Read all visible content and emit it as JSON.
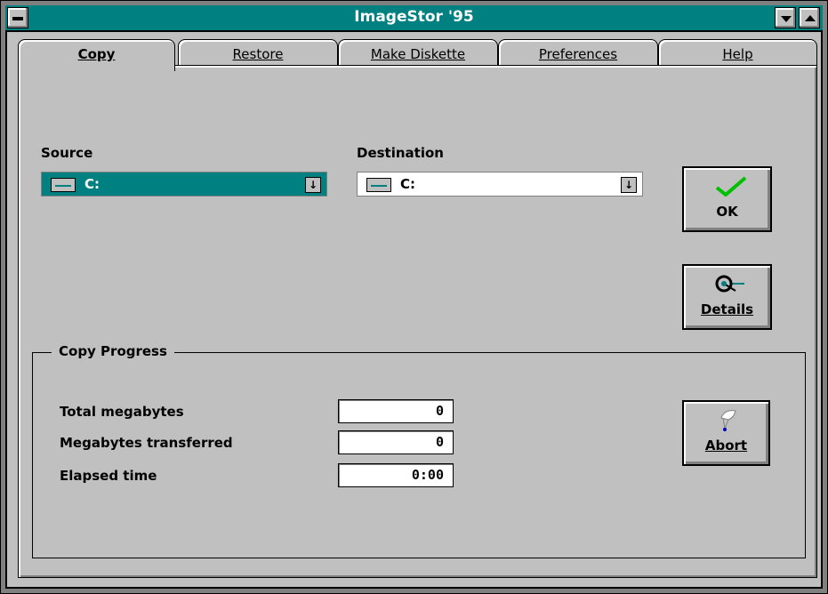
{
  "window": {
    "title": "ImageStor '95"
  },
  "tabs": [
    {
      "label": "Copy"
    },
    {
      "label": "Restore"
    },
    {
      "label": "Make Diskette"
    },
    {
      "label": "Preferences"
    },
    {
      "label": "Help"
    }
  ],
  "source": {
    "label": "Source",
    "value": "C:"
  },
  "destination": {
    "label": "Destination",
    "value": "C:"
  },
  "buttons": {
    "ok": "OK",
    "details": "Details",
    "abort": "Abort"
  },
  "progress": {
    "title": "Copy Progress",
    "fields": [
      {
        "label": "Total megabytes",
        "value": "0"
      },
      {
        "label": "Megabytes transferred",
        "value": "0"
      },
      {
        "label": "Elapsed time",
        "value": "0:00"
      }
    ]
  },
  "colors": {
    "titlebar": "#008080",
    "selected": "#008080",
    "face": "#c0c0c0"
  },
  "icons": {
    "ok": "checkmark-icon",
    "details": "magnifier-icon",
    "abort": "parachute-icon",
    "drive": "drive-icon"
  }
}
